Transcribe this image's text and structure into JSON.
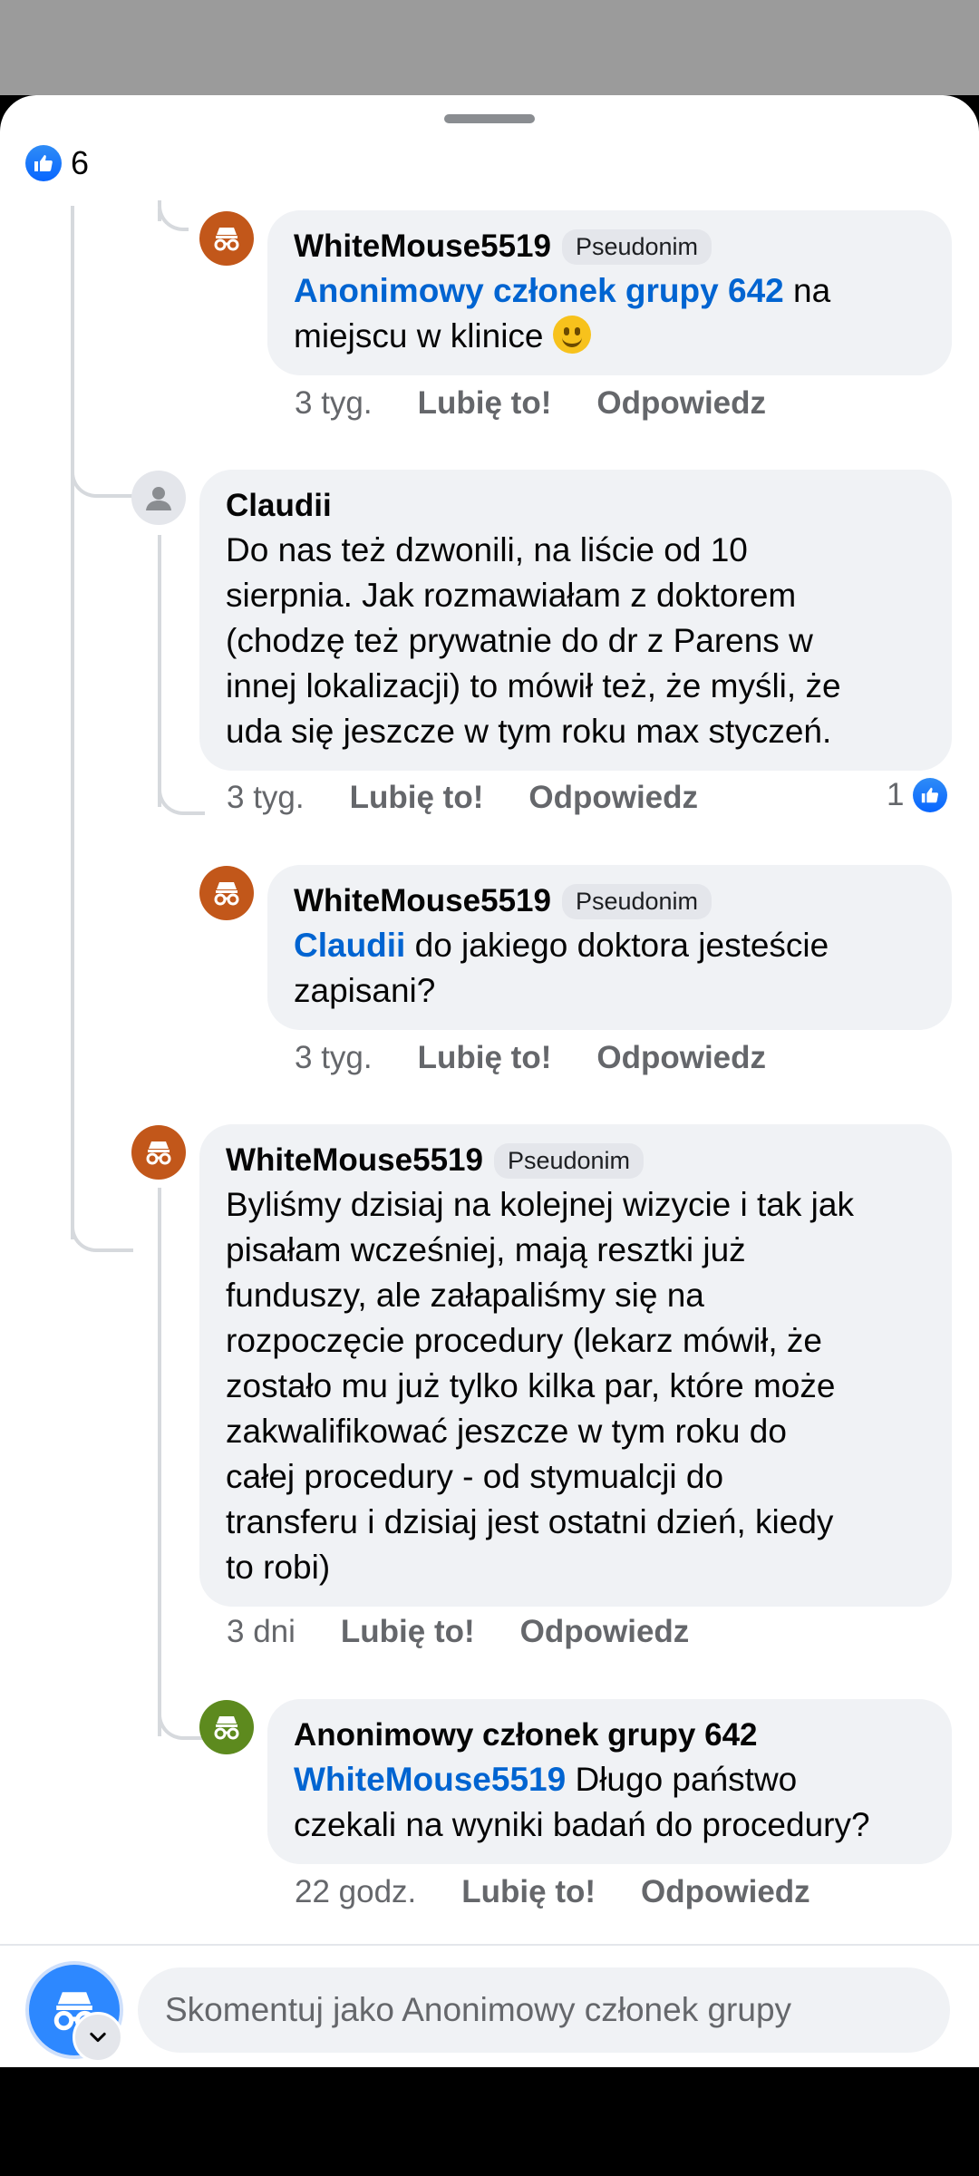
{
  "reactions": {
    "count": "6"
  },
  "comments": [
    {
      "author": "WhiteMouse5519",
      "badge": "Pseudonim",
      "mention": "Anonimowy członek grupy 642",
      "text_after_mention": " na",
      "text_line2": "miejscu w klinice",
      "emoji": "slightly-smiling-face",
      "time": "3 tyg.",
      "like_label": "Lubię to!",
      "reply_label": "Odpowiedz"
    },
    {
      "author": "Claudii",
      "lines": [
        "Do nas też dzwonili, na liście od 10",
        "sierpnia. Jak rozmawiałam z doktorem",
        "(chodzę też prywatnie do dr z Parens w",
        "innej lokalizacji) to mówił też, że myśli, że",
        "uda się jeszcze w tym roku max styczeń."
      ],
      "time": "3 tyg.",
      "like_label": "Lubię to!",
      "reply_label": "Odpowiedz",
      "like_count": "1"
    },
    {
      "author": "WhiteMouse5519",
      "badge": "Pseudonim",
      "mention": "Claudii",
      "text_after_mention": " do jakiego doktora jesteście",
      "text_line2": "zapisani?",
      "time": "3 tyg.",
      "like_label": "Lubię to!",
      "reply_label": "Odpowiedz"
    },
    {
      "author": "WhiteMouse5519",
      "badge": "Pseudonim",
      "lines": [
        "Byliśmy dzisiaj na kolejnej wizycie i tak jak",
        "pisałam wcześniej, mają resztki już",
        "funduszy, ale załapaliśmy się na",
        "rozpoczęcie procedury (lekarz mówił, że",
        "zostało mu już tylko kilka par, które może",
        "zakwalifikować jeszcze w tym roku do",
        "całej procedury - od stymualcji do",
        "transferu i dzisiaj jest ostatni dzień, kiedy",
        "to robi)"
      ],
      "time": "3 dni",
      "like_label": "Lubię to!",
      "reply_label": "Odpowiedz"
    },
    {
      "author": "Anonimowy członek grupy 642",
      "mention": "WhiteMouse5519",
      "text_after_mention": " Długo państwo",
      "text_line2": "czekali na wyniki badań do procedury?",
      "time": "22 godz.",
      "like_label": "Lubię to!",
      "reply_label": "Odpowiedz"
    }
  ],
  "composer": {
    "placeholder": "Skomentuj jako Anonimowy członek grupy"
  },
  "colors": {
    "mention": "#0064d1",
    "like_blue": "#0866ff",
    "avatar_orange": "#c2571a",
    "avatar_green": "#5d8a1e"
  }
}
